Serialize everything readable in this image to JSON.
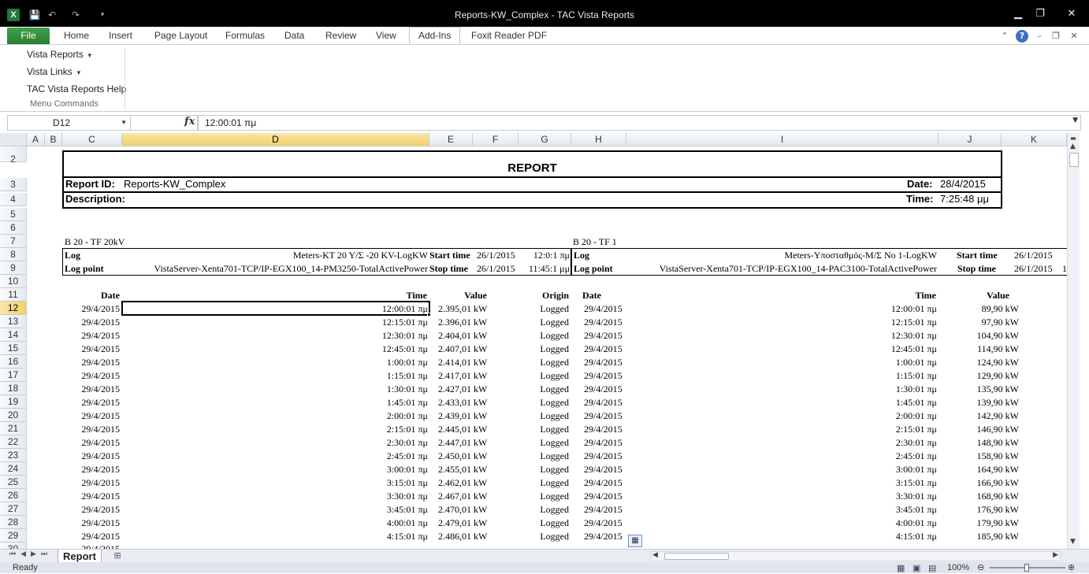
{
  "window": {
    "title": "Reports-KW_Complex  -  TAC Vista Reports",
    "app_icon": "X"
  },
  "qat": {
    "save": "💾",
    "undo": "↶",
    "redo": "↷"
  },
  "tabs": [
    "File",
    "Home",
    "Insert",
    "Page Layout",
    "Formulas",
    "Data",
    "Review",
    "View",
    "Add-Ins",
    "Foxit Reader PDF"
  ],
  "ribbon": {
    "menus": [
      "Vista Reports",
      "Vista Links",
      "TAC Vista Reports Help"
    ],
    "group_label": "Menu Commands"
  },
  "formula_bar": {
    "name_box": "D12",
    "fx": "fx",
    "formula": "12:00:01 πμ"
  },
  "columns": [
    "A",
    "B",
    "C",
    "D",
    "E",
    "F",
    "G",
    "H",
    "I",
    "J",
    "K"
  ],
  "rows": [
    "2",
    "3",
    "4",
    "5",
    "6",
    "7",
    "8",
    "9",
    "10",
    "11",
    "12",
    "13",
    "14",
    "15",
    "16",
    "17",
    "18",
    "19",
    "20",
    "21",
    "22",
    "23",
    "24",
    "25",
    "26",
    "27",
    "28",
    "29",
    "30"
  ],
  "report": {
    "title": "REPORT",
    "report_id_label": "Report ID:",
    "report_id": "Reports-KW_Complex",
    "description_label": "Description:",
    "date_label": "Date:",
    "date": "28/4/2015",
    "time_label": "Time:",
    "time": "7:25:48 μμ"
  },
  "left_block": {
    "name": "B 20 - TF 20kV",
    "log_label": "Log",
    "log": "Meters-KT 20 Y/Σ -20 KV-LogKW",
    "log_point_label": "Log point",
    "log_point": "VistaServer-Xenta701-TCP/IP-EGX100_14-PM3250-TotalActivePower",
    "start_label": "Start time",
    "start_date": "26/1/2015",
    "start_time": "12:0:1 πμ",
    "stop_label": "Stop time",
    "stop_date": "26/1/2015",
    "stop_time": "11:45:1 μμ",
    "headers": {
      "date": "Date",
      "time": "Time",
      "value": "Value",
      "origin": "Origin"
    }
  },
  "right_block": {
    "name": "B 20 - TF 1",
    "log_label": "Log",
    "log": "Meters-Υποσταθμός-Μ/Σ No 1-LogKW",
    "log_point_label": "Log point",
    "log_point": "VistaServer-Xenta701-TCP/IP-EGX100_14-PAC3100-TotalActivePower",
    "start_label": "Start time",
    "start_date": "26/1/2015",
    "stop_label": "Stop time",
    "stop_date": "26/1/2015",
    "stop_time_partial": "1",
    "headers": {
      "date": "Date",
      "time": "Time",
      "value": "Value"
    }
  },
  "data_rows": [
    {
      "date": "29/4/2015",
      "time": "12:00:01 πμ",
      "value": "2.395,01 kW",
      "origin": "Logged",
      "date2": "29/4/2015",
      "time2": "12:00:01 πμ",
      "value2": "89,90 kW"
    },
    {
      "date": "29/4/2015",
      "time": "12:15:01 πμ",
      "value": "2.396,01 kW",
      "origin": "Logged",
      "date2": "29/4/2015",
      "time2": "12:15:01 πμ",
      "value2": "97,90 kW"
    },
    {
      "date": "29/4/2015",
      "time": "12:30:01 πμ",
      "value": "2.404,01 kW",
      "origin": "Logged",
      "date2": "29/4/2015",
      "time2": "12:30:01 πμ",
      "value2": "104,90 kW"
    },
    {
      "date": "29/4/2015",
      "time": "12:45:01 πμ",
      "value": "2.407,01 kW",
      "origin": "Logged",
      "date2": "29/4/2015",
      "time2": "12:45:01 πμ",
      "value2": "114,90 kW"
    },
    {
      "date": "29/4/2015",
      "time": "1:00:01 πμ",
      "value": "2.414,01 kW",
      "origin": "Logged",
      "date2": "29/4/2015",
      "time2": "1:00:01 πμ",
      "value2": "124,90 kW"
    },
    {
      "date": "29/4/2015",
      "time": "1:15:01 πμ",
      "value": "2.417,01 kW",
      "origin": "Logged",
      "date2": "29/4/2015",
      "time2": "1:15:01 πμ",
      "value2": "129,90 kW"
    },
    {
      "date": "29/4/2015",
      "time": "1:30:01 πμ",
      "value": "2.427,01 kW",
      "origin": "Logged",
      "date2": "29/4/2015",
      "time2": "1:30:01 πμ",
      "value2": "135,90 kW"
    },
    {
      "date": "29/4/2015",
      "time": "1:45:01 πμ",
      "value": "2.433,01 kW",
      "origin": "Logged",
      "date2": "29/4/2015",
      "time2": "1:45:01 πμ",
      "value2": "139,90 kW"
    },
    {
      "date": "29/4/2015",
      "time": "2:00:01 πμ",
      "value": "2.439,01 kW",
      "origin": "Logged",
      "date2": "29/4/2015",
      "time2": "2:00:01 πμ",
      "value2": "142,90 kW"
    },
    {
      "date": "29/4/2015",
      "time": "2:15:01 πμ",
      "value": "2.445,01 kW",
      "origin": "Logged",
      "date2": "29/4/2015",
      "time2": "2:15:01 πμ",
      "value2": "146,90 kW"
    },
    {
      "date": "29/4/2015",
      "time": "2:30:01 πμ",
      "value": "2.447,01 kW",
      "origin": "Logged",
      "date2": "29/4/2015",
      "time2": "2:30:01 πμ",
      "value2": "148,90 kW"
    },
    {
      "date": "29/4/2015",
      "time": "2:45:01 πμ",
      "value": "2.450,01 kW",
      "origin": "Logged",
      "date2": "29/4/2015",
      "time2": "2:45:01 πμ",
      "value2": "158,90 kW"
    },
    {
      "date": "29/4/2015",
      "time": "3:00:01 πμ",
      "value": "2.455,01 kW",
      "origin": "Logged",
      "date2": "29/4/2015",
      "time2": "3:00:01 πμ",
      "value2": "164,90 kW"
    },
    {
      "date": "29/4/2015",
      "time": "3:15:01 πμ",
      "value": "2.462,01 kW",
      "origin": "Logged",
      "date2": "29/4/2015",
      "time2": "3:15:01 πμ",
      "value2": "166,90 kW"
    },
    {
      "date": "29/4/2015",
      "time": "3:30:01 πμ",
      "value": "2.467,01 kW",
      "origin": "Logged",
      "date2": "29/4/2015",
      "time2": "3:30:01 πμ",
      "value2": "168,90 kW"
    },
    {
      "date": "29/4/2015",
      "time": "3:45:01 πμ",
      "value": "2.470,01 kW",
      "origin": "Logged",
      "date2": "29/4/2015",
      "time2": "3:45:01 πμ",
      "value2": "176,90 kW"
    },
    {
      "date": "29/4/2015",
      "time": "4:00:01 πμ",
      "value": "2.479,01 kW",
      "origin": "Logged",
      "date2": "29/4/2015",
      "time2": "4:00:01 πμ",
      "value2": "179,90 kW"
    },
    {
      "date": "29/4/2015",
      "time": "4:15:01 πμ",
      "value": "2.486,01 kW",
      "origin": "Logged",
      "date2": "29/4/2015",
      "time2": "4:15:01 πμ",
      "value2": "185,90 kW"
    }
  ],
  "sheet_tab": "Report",
  "status": {
    "text": "Ready",
    "zoom": "100%"
  }
}
